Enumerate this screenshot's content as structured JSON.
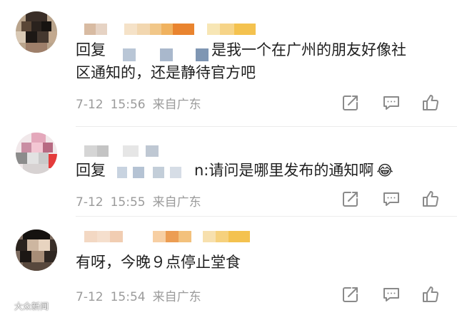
{
  "comments": [
    {
      "body_prefix": "回复",
      "body_line1": "是我一个在广州的朋友好像社",
      "body_line2": "区通知的，还是静待官方吧",
      "date": "7-12",
      "time": "15:56",
      "location": "来自广东"
    },
    {
      "body_prefix": "回复",
      "body_line1": "n:请问是哪里发布的通知啊",
      "emoji": "😂",
      "date": "7-12",
      "time": "15:55",
      "location": "来自广东"
    },
    {
      "body_line1": "有呀，今晚９点停止堂食",
      "date": "7-12",
      "time": "15:54",
      "location": "来自广东"
    }
  ],
  "watermark": "大众新闻",
  "icons": {
    "share": "share-icon",
    "reply": "comment-icon",
    "like": "thumbs-up-icon"
  },
  "colors": {
    "text": "#1f1f1f",
    "meta": "#9b9b9b",
    "icon": "#8a8a8a"
  }
}
